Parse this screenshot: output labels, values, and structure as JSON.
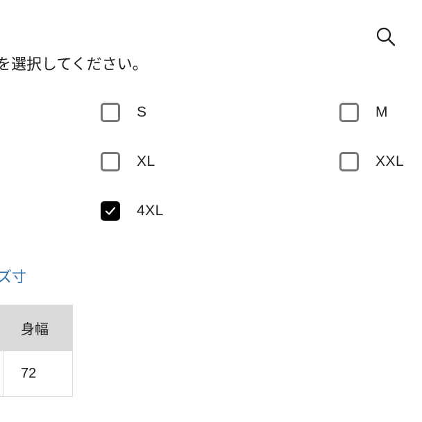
{
  "header": {
    "search_icon": "search-icon"
  },
  "instruction": {
    "text": "を選択してください。"
  },
  "size_options": [
    {
      "label": "S",
      "checked": false
    },
    {
      "label": "M",
      "checked": false
    },
    {
      "label": "XL",
      "checked": false
    },
    {
      "label": "XXL",
      "checked": false
    },
    {
      "label": "4XL",
      "checked": true
    }
  ],
  "size_link": {
    "label": "ズ寸"
  },
  "size_table": {
    "headers": [
      "身幅"
    ],
    "rows": [
      [
        "72"
      ]
    ]
  },
  "colors": {
    "checkbox_checked": "#000000",
    "checkbox_border": "#767676",
    "link": "#2b6ea6",
    "table_header_bg": "#d9d9d9"
  }
}
